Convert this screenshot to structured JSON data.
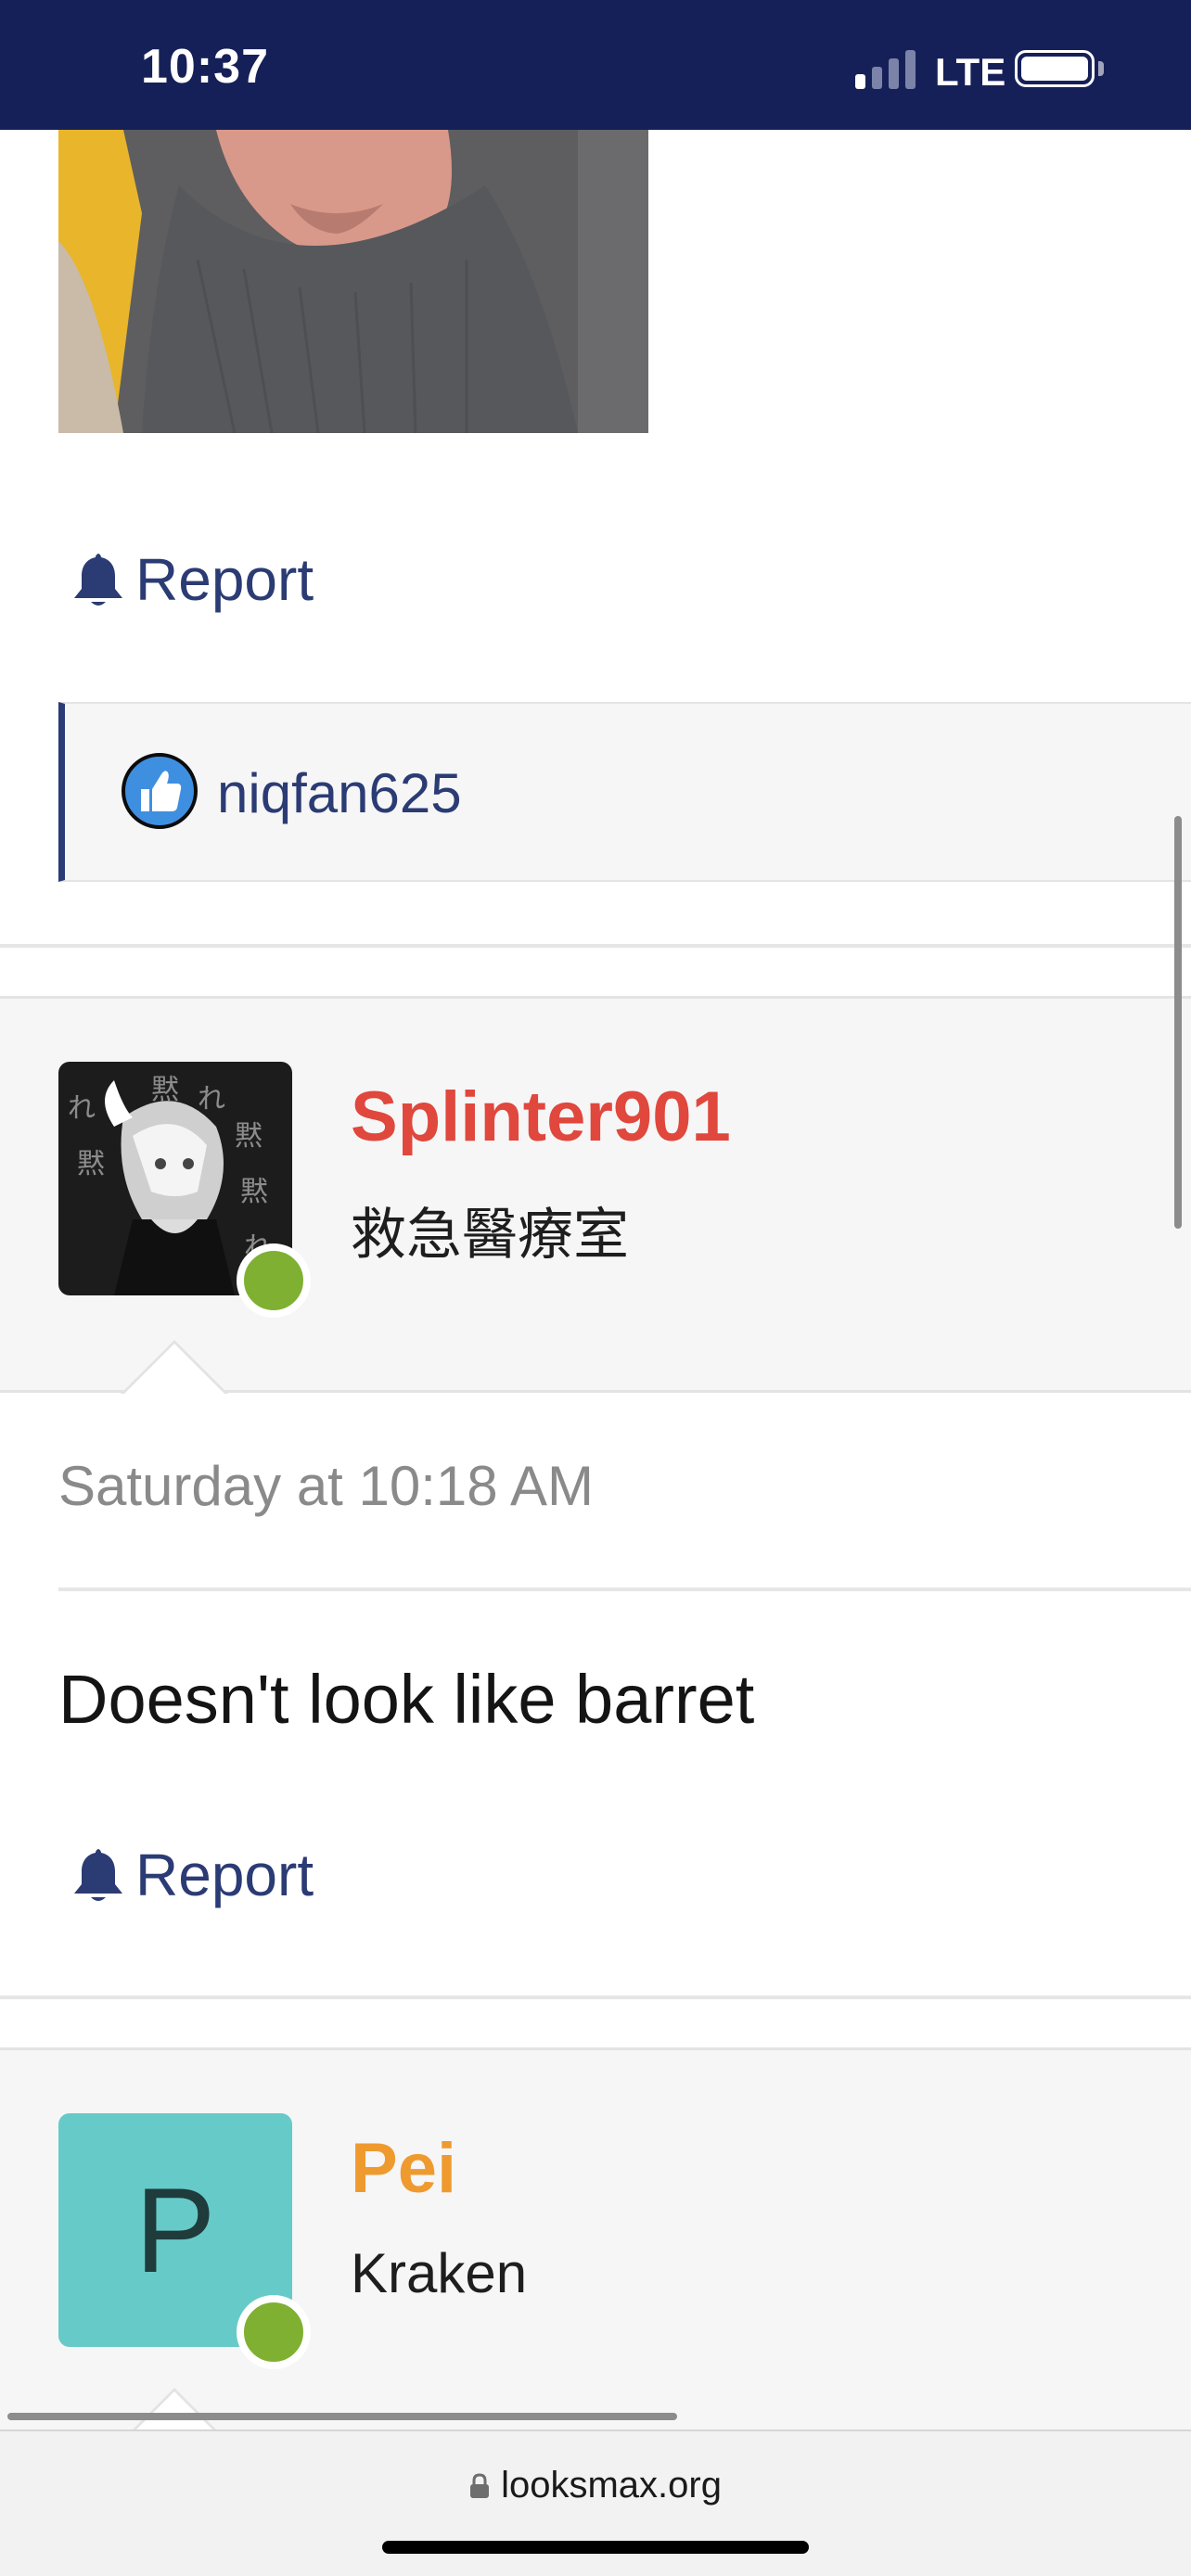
{
  "status_bar": {
    "time": "10:37",
    "network": "LTE",
    "signal_bars_active": 1,
    "signal_bars_total": 4
  },
  "post_above": {
    "report_label": "Report",
    "reactions": {
      "icon": "thumbs-up-icon",
      "user": "niqfan625"
    }
  },
  "post": {
    "author": {
      "name": "Splinter901",
      "title": "救急醫療室",
      "name_color": "#e0473d",
      "online": true
    },
    "date": "Saturday at 10:18 AM",
    "body": "Doesn't look like barret",
    "report_label": "Report"
  },
  "next_post": {
    "author": {
      "name": "Pei",
      "title": "Kraken",
      "avatar_letter": "P",
      "name_color": "#ef9a2f",
      "avatar_color": "#66cac8",
      "online": true
    }
  },
  "browser": {
    "url": "looksmax.org"
  },
  "colors": {
    "status_bar_bg": "#162058",
    "link": "#2b3b74",
    "online": "#7fb032"
  }
}
